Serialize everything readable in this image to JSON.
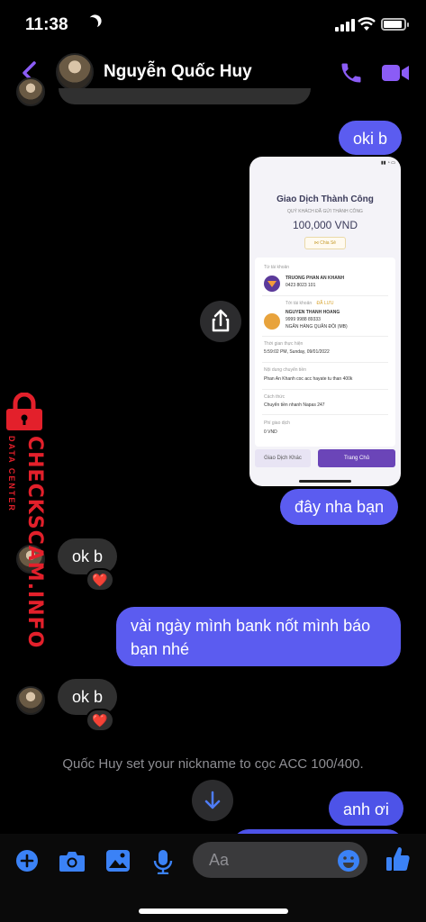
{
  "status_bar": {
    "time": "11:38"
  },
  "header": {
    "contact_name": "Nguyễn Quốc Huy"
  },
  "messages": {
    "m1": "oki b",
    "m2": "đây nha bạn",
    "m3": "ok b",
    "m4": "vài ngày mình bank nốt mình báo bạn nhé",
    "m5": "ok b",
    "m6": "anh ơi"
  },
  "reactions": {
    "r1": "❤️",
    "r2": "❤️"
  },
  "receipt": {
    "title": "Giao Dịch Thành Công",
    "subtitle": "QUÝ KHÁCH ĐÃ GỬI THÀNH CÔNG",
    "amount": "100,000 VND",
    "share_label": "Chia Sẻ",
    "from_label": "Từ tài khoản",
    "from_name": "TRUONG PHAN AN KHANH",
    "from_account": "0423 8023 101",
    "to_label": "Tới tài khoản",
    "to_saved": "ĐÃ LƯU",
    "to_name": "NGUYEN THANH HOANG",
    "to_account": "9999 9988 89333",
    "to_bank": "NGÂN HÀNG QUÂN ĐỘI (MB)",
    "time_label": "Thời gian thực hiện",
    "time_value": "5:59:02 PM, Sunday, 09/01/2022",
    "content_label": "Nội dung chuyển tiền",
    "content_value": "Phan An Khanh coc acc hayate tu than 400k",
    "method_label": "Cách thức",
    "method_value": "Chuyển tiền nhanh Napas 247",
    "fee_label": "Phí giao dịch",
    "fee_value": "0 VND",
    "btn_other": "Giao Dịch Khác",
    "btn_home": "Trang Chủ"
  },
  "system_message": "Quốc Huy set your nickname to cọc ACC 100/400.",
  "composer": {
    "placeholder": "Aa"
  },
  "watermark": {
    "main": "CHECKSCAM.INFO",
    "sub": "DATA CENTER"
  },
  "colors": {
    "accent": "#5b5cf0",
    "icon_blue": "#3b82f6",
    "header_purple": "#8b5cf6",
    "watermark_red": "#e3202b"
  }
}
